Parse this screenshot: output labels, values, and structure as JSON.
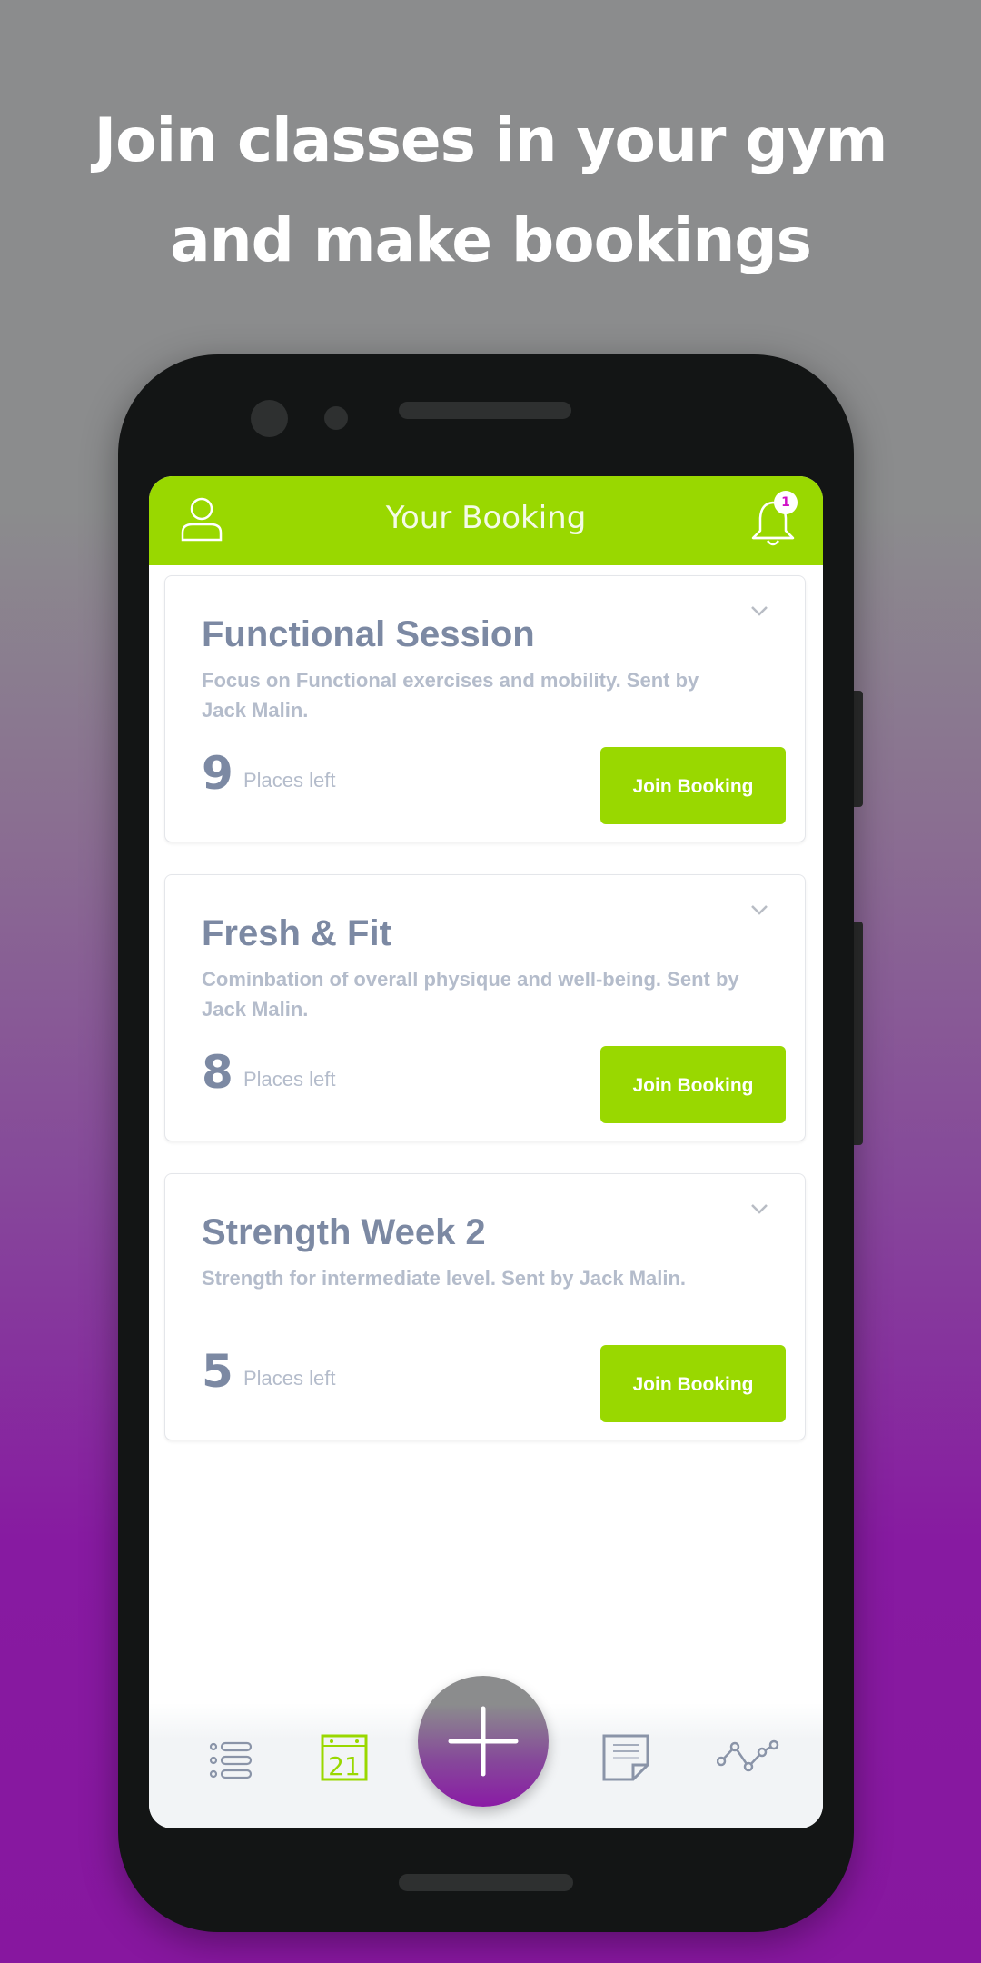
{
  "headline": {
    "line1": "Join classes in your gym",
    "line2": "and make bookings"
  },
  "colors": {
    "accent": "#99d800",
    "title_text": "#7c89a3",
    "muted_text": "#b4bccb",
    "badge_text": "#d010c8",
    "fab_bottom": "#8a1ba5"
  },
  "appbar": {
    "title": "Your Booking",
    "left_icon": "user-icon",
    "right_icon": "bell-icon",
    "notification_count": "1"
  },
  "bookings": [
    {
      "title": "Functional Session",
      "description": "Focus on Functional exercises and mobility. Sent by Jack Malin.",
      "places": "9",
      "places_label": "Places left",
      "button_label": "Join Booking"
    },
    {
      "title": "Fresh & Fit",
      "description": "Cominbation of overall physique and well-being. Sent by Jack Malin.",
      "places": "8",
      "places_label": "Places left",
      "button_label": "Join Booking"
    },
    {
      "title": "Strength Week 2",
      "description": "Strength for intermediate level. Sent by Jack Malin.",
      "places": "5",
      "places_label": "Places left",
      "button_label": "Join Booking"
    }
  ],
  "bottom_nav": {
    "items": [
      {
        "icon": "list-icon",
        "active": false
      },
      {
        "icon": "calendar-icon",
        "label": "21",
        "active": true
      },
      {
        "icon": "add-icon",
        "active": false
      },
      {
        "icon": "notes-icon",
        "active": false
      },
      {
        "icon": "stats-icon",
        "active": false
      }
    ]
  }
}
